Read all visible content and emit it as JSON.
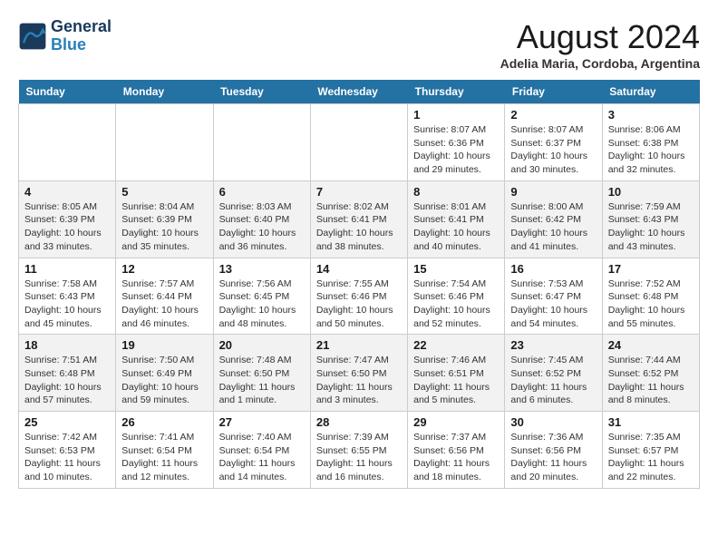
{
  "logo": {
    "line1": "General",
    "line2": "Blue"
  },
  "title": "August 2024",
  "subtitle": "Adelia Maria, Cordoba, Argentina",
  "headers": [
    "Sunday",
    "Monday",
    "Tuesday",
    "Wednesday",
    "Thursday",
    "Friday",
    "Saturday"
  ],
  "weeks": [
    [
      {
        "day": "",
        "text": ""
      },
      {
        "day": "",
        "text": ""
      },
      {
        "day": "",
        "text": ""
      },
      {
        "day": "",
        "text": ""
      },
      {
        "day": "1",
        "text": "Sunrise: 8:07 AM\nSunset: 6:36 PM\nDaylight: 10 hours\nand 29 minutes."
      },
      {
        "day": "2",
        "text": "Sunrise: 8:07 AM\nSunset: 6:37 PM\nDaylight: 10 hours\nand 30 minutes."
      },
      {
        "day": "3",
        "text": "Sunrise: 8:06 AM\nSunset: 6:38 PM\nDaylight: 10 hours\nand 32 minutes."
      }
    ],
    [
      {
        "day": "4",
        "text": "Sunrise: 8:05 AM\nSunset: 6:39 PM\nDaylight: 10 hours\nand 33 minutes."
      },
      {
        "day": "5",
        "text": "Sunrise: 8:04 AM\nSunset: 6:39 PM\nDaylight: 10 hours\nand 35 minutes."
      },
      {
        "day": "6",
        "text": "Sunrise: 8:03 AM\nSunset: 6:40 PM\nDaylight: 10 hours\nand 36 minutes."
      },
      {
        "day": "7",
        "text": "Sunrise: 8:02 AM\nSunset: 6:41 PM\nDaylight: 10 hours\nand 38 minutes."
      },
      {
        "day": "8",
        "text": "Sunrise: 8:01 AM\nSunset: 6:41 PM\nDaylight: 10 hours\nand 40 minutes."
      },
      {
        "day": "9",
        "text": "Sunrise: 8:00 AM\nSunset: 6:42 PM\nDaylight: 10 hours\nand 41 minutes."
      },
      {
        "day": "10",
        "text": "Sunrise: 7:59 AM\nSunset: 6:43 PM\nDaylight: 10 hours\nand 43 minutes."
      }
    ],
    [
      {
        "day": "11",
        "text": "Sunrise: 7:58 AM\nSunset: 6:43 PM\nDaylight: 10 hours\nand 45 minutes."
      },
      {
        "day": "12",
        "text": "Sunrise: 7:57 AM\nSunset: 6:44 PM\nDaylight: 10 hours\nand 46 minutes."
      },
      {
        "day": "13",
        "text": "Sunrise: 7:56 AM\nSunset: 6:45 PM\nDaylight: 10 hours\nand 48 minutes."
      },
      {
        "day": "14",
        "text": "Sunrise: 7:55 AM\nSunset: 6:46 PM\nDaylight: 10 hours\nand 50 minutes."
      },
      {
        "day": "15",
        "text": "Sunrise: 7:54 AM\nSunset: 6:46 PM\nDaylight: 10 hours\nand 52 minutes."
      },
      {
        "day": "16",
        "text": "Sunrise: 7:53 AM\nSunset: 6:47 PM\nDaylight: 10 hours\nand 54 minutes."
      },
      {
        "day": "17",
        "text": "Sunrise: 7:52 AM\nSunset: 6:48 PM\nDaylight: 10 hours\nand 55 minutes."
      }
    ],
    [
      {
        "day": "18",
        "text": "Sunrise: 7:51 AM\nSunset: 6:48 PM\nDaylight: 10 hours\nand 57 minutes."
      },
      {
        "day": "19",
        "text": "Sunrise: 7:50 AM\nSunset: 6:49 PM\nDaylight: 10 hours\nand 59 minutes."
      },
      {
        "day": "20",
        "text": "Sunrise: 7:48 AM\nSunset: 6:50 PM\nDaylight: 11 hours\nand 1 minute."
      },
      {
        "day": "21",
        "text": "Sunrise: 7:47 AM\nSunset: 6:50 PM\nDaylight: 11 hours\nand 3 minutes."
      },
      {
        "day": "22",
        "text": "Sunrise: 7:46 AM\nSunset: 6:51 PM\nDaylight: 11 hours\nand 5 minutes."
      },
      {
        "day": "23",
        "text": "Sunrise: 7:45 AM\nSunset: 6:52 PM\nDaylight: 11 hours\nand 6 minutes."
      },
      {
        "day": "24",
        "text": "Sunrise: 7:44 AM\nSunset: 6:52 PM\nDaylight: 11 hours\nand 8 minutes."
      }
    ],
    [
      {
        "day": "25",
        "text": "Sunrise: 7:42 AM\nSunset: 6:53 PM\nDaylight: 11 hours\nand 10 minutes."
      },
      {
        "day": "26",
        "text": "Sunrise: 7:41 AM\nSunset: 6:54 PM\nDaylight: 11 hours\nand 12 minutes."
      },
      {
        "day": "27",
        "text": "Sunrise: 7:40 AM\nSunset: 6:54 PM\nDaylight: 11 hours\nand 14 minutes."
      },
      {
        "day": "28",
        "text": "Sunrise: 7:39 AM\nSunset: 6:55 PM\nDaylight: 11 hours\nand 16 minutes."
      },
      {
        "day": "29",
        "text": "Sunrise: 7:37 AM\nSunset: 6:56 PM\nDaylight: 11 hours\nand 18 minutes."
      },
      {
        "day": "30",
        "text": "Sunrise: 7:36 AM\nSunset: 6:56 PM\nDaylight: 11 hours\nand 20 minutes."
      },
      {
        "day": "31",
        "text": "Sunrise: 7:35 AM\nSunset: 6:57 PM\nDaylight: 11 hours\nand 22 minutes."
      }
    ]
  ]
}
